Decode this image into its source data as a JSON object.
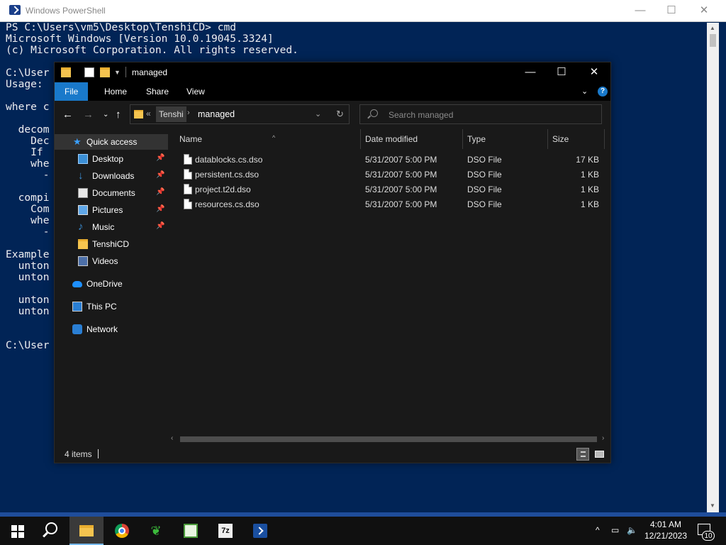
{
  "powershell": {
    "title": "Windows PowerShell",
    "lines": [
      "PS C:\\Users\\vm5\\Desktop\\TenshiCD> cmd",
      "Microsoft Windows [Version 10.0.19045.3324]",
      "(c) Microsoft Corporation. All rights reserved.",
      "",
      "C:\\User",
      "Usage:",
      "",
      "where c",
      "",
      "  decom",
      "    Dec",
      "    If",
      "    whe",
      "      -",
      "",
      "  compi",
      "    Com",
      "    whe",
      "      -",
      "",
      "Example",
      "  unton",
      "  unton",
      "",
      "  unton",
      "  unton",
      "",
      "",
      "C:\\User"
    ]
  },
  "explorer": {
    "title": "managed",
    "ribbon": {
      "tabs": [
        "File",
        "Home",
        "Share",
        "View"
      ]
    },
    "address": {
      "overflow": "«",
      "crumb1": "Tenshi",
      "crumb2": "managed"
    },
    "search": {
      "placeholder": "Search managed"
    },
    "nav": {
      "quick_access": "Quick access",
      "desktop": "Desktop",
      "downloads": "Downloads",
      "documents": "Documents",
      "pictures": "Pictures",
      "music": "Music",
      "tenshicd": "TenshiCD",
      "videos": "Videos",
      "onedrive": "OneDrive",
      "this_pc": "This PC",
      "network": "Network"
    },
    "columns": {
      "name": "Name",
      "date": "Date modified",
      "type": "Type",
      "size": "Size"
    },
    "files": [
      {
        "name": "datablocks.cs.dso",
        "date": "5/31/2007 5:00 PM",
        "type": "DSO File",
        "size": "17 KB"
      },
      {
        "name": "persistent.cs.dso",
        "date": "5/31/2007 5:00 PM",
        "type": "DSO File",
        "size": "1 KB"
      },
      {
        "name": "project.t2d.dso",
        "date": "5/31/2007 5:00 PM",
        "type": "DSO File",
        "size": "1 KB"
      },
      {
        "name": "resources.cs.dso",
        "date": "5/31/2007 5:00 PM",
        "type": "DSO File",
        "size": "1 KB"
      }
    ],
    "status": {
      "count": "4 items"
    }
  },
  "taskbar": {
    "clock_time": "4:01 AM",
    "clock_date": "12/21/2023",
    "notifications": "10",
    "seven_zip_label": "7z"
  },
  "colors": {
    "ps_background": "#012456",
    "explorer_bg": "#191919",
    "accent": "#1979ca"
  }
}
